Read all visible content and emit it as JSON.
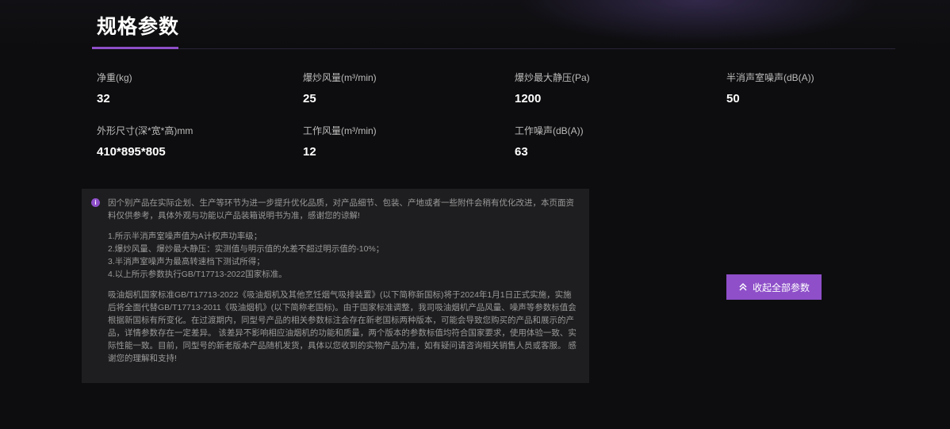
{
  "section": {
    "title": "规格参数"
  },
  "specs": [
    {
      "label": "净重(kg)",
      "value": "32"
    },
    {
      "label": "爆炒风量(m³/min)",
      "value": "25"
    },
    {
      "label": "爆炒最大静压(Pa)",
      "value": "1200"
    },
    {
      "label": "半消声室噪声(dB(A))",
      "value": "50"
    },
    {
      "label": "外形尺寸(深*宽*高)mm",
      "value": "410*895*805"
    },
    {
      "label": "工作风量(m³/min)",
      "value": "12"
    },
    {
      "label": "工作噪声(dB(A))",
      "value": "63"
    }
  ],
  "notice": {
    "icon": "info-icon",
    "intro": "因个别产品在实际企划、生产等环节为进一步提升优化品质，对产品细节、包装、产地或者一些附件会稍有优化改进，本页面资料仅供参考，具体外观与功能以产品装箱说明书为准，感谢您的谅解!",
    "notes": [
      "1.所示半消声室噪声值为A计权声功率级；",
      "2.爆炒风量、爆炒最大静压：实测值与明示值的允差不超过明示值的-10%；",
      "3.半消声室噪声为最高转速档下测试所得；",
      "4.以上所示参数执行GB/T17713-2022国家标准。"
    ],
    "standard_text": "吸油烟机国家标准GB/T17713-2022《吸油烟机及其他烹饪烟气吸排装置》(以下简称新国标)将于2024年1月1日正式实施，实施后将全面代替GB/T17713-2011《吸油烟机》(以下简称老国标)。由于国家标准调整，我司吸油烟机产品风量、噪声等参数标值会根据新国标有所变化。在过渡期内，同型号产品的相关参数标注会存在新老国标两种版本，可能会导致您购买的产品和展示的产品，详情参数存在一定差异。 该差异不影响相应油烟机的功能和质量，两个版本的参数标值均符合国家要求，使用体验一致、实际性能一致。目前，同型号的新老版本产品随机发货，具体以您收到的实物产品为准，如有疑问请咨询相关销售人员或客服。 感谢您的理解和支持!"
  },
  "collapse_button": {
    "label": "收起全部参数",
    "icon": "chevron-double-up-icon"
  },
  "colors": {
    "accent": "#8e4fc9",
    "background": "#0d0d0f",
    "notice_bg": "#1e1e20"
  }
}
